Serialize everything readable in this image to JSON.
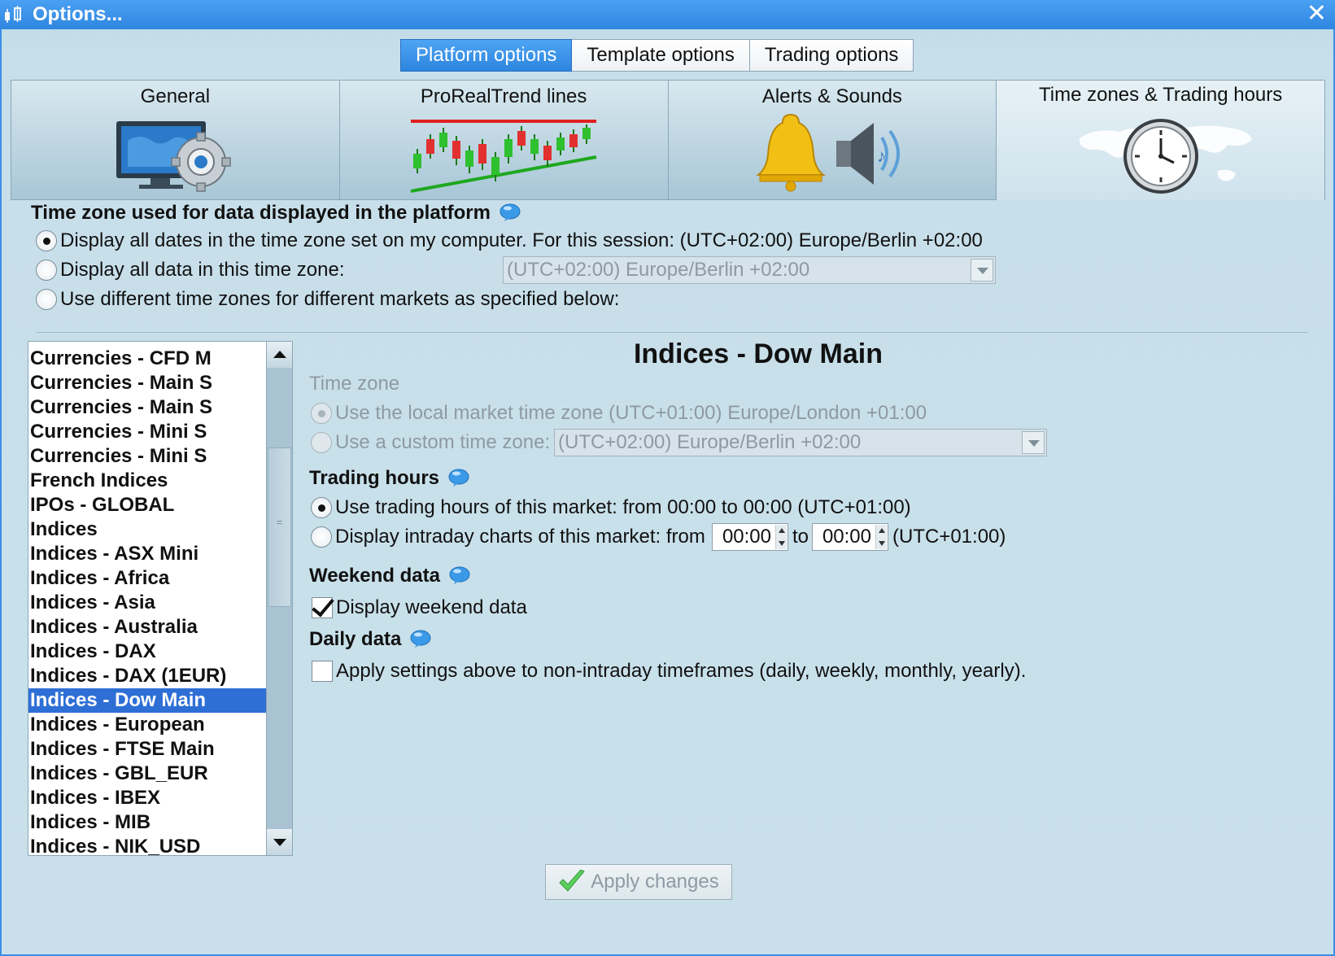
{
  "window": {
    "title": "Options...",
    "close_glyph": "✕"
  },
  "top_tabs": [
    {
      "label": "Platform options",
      "active": true
    },
    {
      "label": "Template options",
      "active": false
    },
    {
      "label": "Trading options",
      "active": false
    }
  ],
  "category_tabs": [
    {
      "label": "General",
      "icon": "monitor-gear-icon"
    },
    {
      "label": "ProRealTrend lines",
      "icon": "trendline-chart-icon"
    },
    {
      "label": "Alerts & Sounds",
      "icon": "bell-speaker-icon"
    },
    {
      "label": "Time zones & Trading hours",
      "icon": "world-clock-icon",
      "active": true
    }
  ],
  "timezone_section": {
    "heading": "Time zone used for data displayed in the platform",
    "option1": "Display all dates in the time zone set on my computer. For this session:  (UTC+02:00) Europe/Berlin +02:00",
    "option2": "Display all data in this time zone:",
    "option2_value": "(UTC+02:00) Europe/Berlin +02:00",
    "option3": "Use different time zones for different markets as specified below:",
    "selected": 1
  },
  "market_list": {
    "items": [
      "Currencies - CFD M",
      "Currencies - Main S",
      "Currencies - Main S",
      "Currencies - Mini S",
      "Currencies - Mini S",
      "French Indices",
      "IPOs - GLOBAL",
      "Indices",
      "Indices - ASX Mini",
      "Indices - Africa",
      "Indices - Asia",
      "Indices - Australia",
      "Indices - DAX",
      "Indices - DAX (1EUR)",
      "Indices - Dow Main",
      "Indices - European",
      "Indices - FTSE Main",
      "Indices - GBL_EUR",
      "Indices - IBEX",
      "Indices - MIB",
      "Indices - NIK_USD"
    ],
    "selected": "Indices - Dow Main"
  },
  "market_panel": {
    "title": "Indices - Dow Main",
    "timezone_heading": "Time zone",
    "tz_option1": "Use the local market time zone (UTC+01:00) Europe/London +01:00",
    "tz_option2": "Use a custom time zone:",
    "tz_custom_value": "(UTC+02:00) Europe/Berlin +02:00",
    "trading_heading": "Trading hours",
    "trading_option1": "Use trading hours of this market: from 00:00 to 00:00 (UTC+01:00)",
    "trading_option2_prefix": "Display intraday charts of this market: from",
    "from_value": "00:00",
    "to_label": "to",
    "to_value": "00:00",
    "trading_option2_suffix": "(UTC+01:00)",
    "weekend_heading": "Weekend data",
    "weekend_label": "Display weekend data",
    "weekend_checked": true,
    "daily_heading": "Daily data",
    "daily_label": "Apply settings above to non-intraday timeframes (daily, weekly, monthly, yearly).",
    "daily_checked": false
  },
  "apply_button": {
    "label": "Apply changes"
  },
  "colors": {
    "accent": "#2e86e0",
    "selection": "#2e6fd6",
    "panel": "#c9e0ea"
  }
}
